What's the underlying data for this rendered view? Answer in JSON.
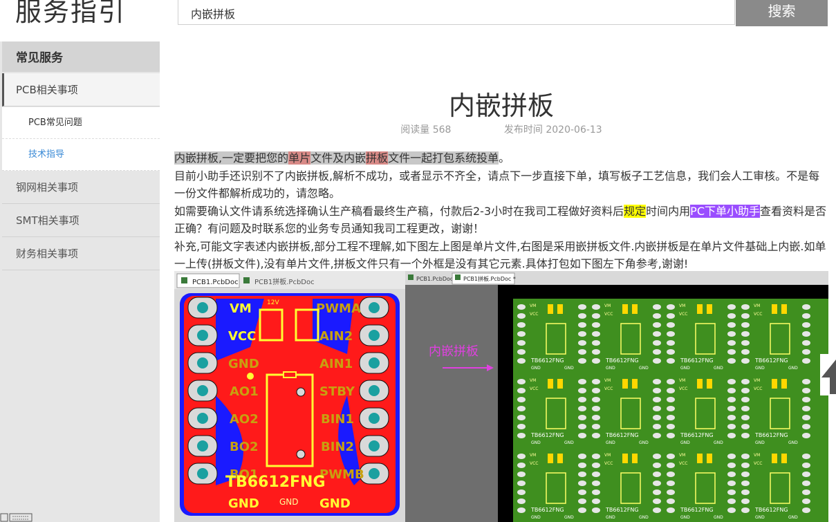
{
  "brand": {
    "title": "服务指引"
  },
  "search": {
    "value": "内嵌拼板",
    "button_label": "搜索"
  },
  "sidebar": {
    "heading": "常见服务",
    "items": [
      {
        "label": "PCB相关事项",
        "active": true
      },
      {
        "label": "PCB常见问题"
      },
      {
        "label": "技术指导",
        "current": true
      },
      {
        "label": "钢网相关事项"
      },
      {
        "label": "SMT相关事项"
      },
      {
        "label": "财务相关事项"
      }
    ]
  },
  "article": {
    "title": "内嵌拼板",
    "read_count": "阅读量 568",
    "publish_time": "发布时间 2020-06-13",
    "p1": {
      "a": "内嵌拼板,一定要把您的",
      "b": "单片",
      "c": "文件及内嵌",
      "d": "拼板",
      "e": "文件一起打包系统投单",
      "f": "。"
    },
    "p2": "目前小助手还识别不了内嵌拼板,解析不成功，或者显示不齐全，请点下一步直接下单，填写板子工艺信息，我们会人工审核。不是每一份文件都解析成功的，请忽略。",
    "p3": {
      "a": "如需要确认文件请系统选择确认生产稿看最终生产稿，付款后2-3小时在我司工程做好资料后",
      "b": "规定",
      "c": "时间内用",
      "d": "PC下单小助手",
      "e": "查看资料是否正确？有问题及时联系您的业务专员通知我司工程更改，谢谢！"
    },
    "p4": "补充,可能文字表述内嵌拼板,部分工程不理解,如下图左上图是单片文件,右图是采用嵌拼板文件.内嵌拼板是在单片文件基础上内嵌.如单一上传(拼板文件),没有单片文件,拼板文件只有一个外框是没有其它元素.具体打包如下图左下角参考,谢谢!"
  },
  "figure": {
    "left_tabs": [
      "PCB1.PcbDoc",
      "PCB1拼板.PcbDoc"
    ],
    "right_tabs": [
      "PCB1.PcbDoc",
      "PCB1拼板.PcbDoc *"
    ],
    "arrow_label": "内嵌拼板",
    "board_name": "TB6612FNG",
    "left_labels": [
      "VM",
      "VCC",
      "GND",
      "AO1",
      "AO2",
      "BO2",
      "BO1"
    ],
    "right_labels": [
      "PWMA",
      "AIN2",
      "AIN1",
      "STBY",
      "BIN1",
      "BIN2",
      "PWMB"
    ],
    "gnd": "GND",
    "v12": "12V",
    "mini_labels": {
      "vm": "VM",
      "vcc": "VCC",
      "gnd": "GND",
      "chip": "TB6612FNG"
    },
    "colors": {
      "board_red": "#ff1a1a",
      "board_blue": "#1a1aff",
      "silk_yellow": "#ffff33",
      "panel_green": "#3f8f1f",
      "bg_dark": "#000000"
    }
  }
}
